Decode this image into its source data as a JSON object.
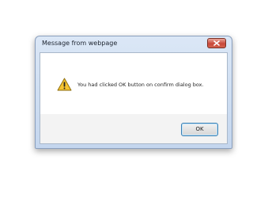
{
  "dialog": {
    "title": "Message from webpage",
    "message": "You had clicked OK button on confirm dialog box.",
    "ok_label": "OK",
    "icons": {
      "warning": "warning-icon",
      "close": "close-icon"
    }
  },
  "colors": {
    "frame": "#c4d6ee",
    "close_button": "#c8473a",
    "ok_border": "#3c7fb1",
    "warning_fill": "#f5c330"
  }
}
